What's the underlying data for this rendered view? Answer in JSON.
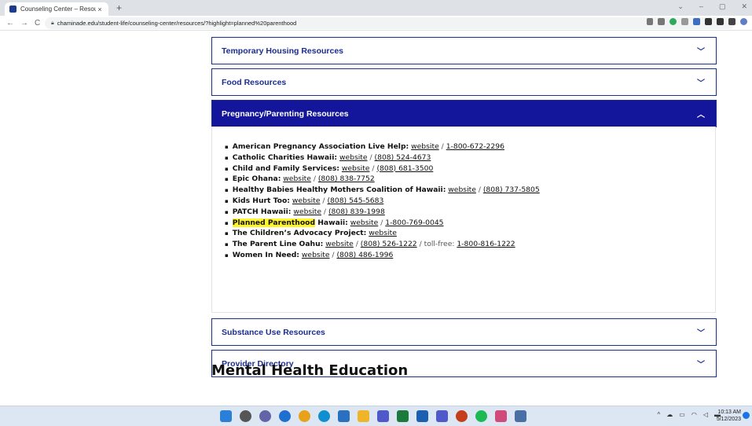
{
  "browser": {
    "tab_title": "Counseling Center – Resources –",
    "tab_close": "×",
    "new_tab": "+",
    "address": "chaminade.edu/student-life/counseling-center/resources/?highlight=planned%20parenthood"
  },
  "accordion": {
    "temporary_housing": "Temporary Housing Resources",
    "food": "Food Resources",
    "pregnancy": "Pregnancy/Parenting Resources",
    "substance": "Substance Use Resources",
    "provider": "Provider Directory"
  },
  "resources": [
    {
      "name": "American Pregnancy Association Live Help:",
      "link": "website",
      "phone": "1-800-672-2296"
    },
    {
      "name": "Catholic Charities Hawaii:",
      "link": "website",
      "phone": "(808) 524-4673"
    },
    {
      "name": "Child and Family Services:",
      "link": "website",
      "phone": "(808) 681-3500"
    },
    {
      "name": "Epic Ohana:",
      "link": "website",
      "phone": "(808) 838-7752"
    },
    {
      "name": "Healthy Babies Healthy Mothers Coalition of Hawaii:",
      "link": "website",
      "phone": "(808) 737-5805"
    },
    {
      "name": "Kids Hurt Too:",
      "link": "website",
      "phone": "(808) 545-5683"
    },
    {
      "name": "PATCH Hawaii:",
      "link": "website",
      "phone": "(808) 839-1998"
    },
    {
      "name_highlight": "Planned Parenthood",
      "name_rest": " Hawaii:",
      "link": "website",
      "phone": "1-800-769-0045"
    },
    {
      "name": "The Children’s Advocacy Project:",
      "link": "website"
    },
    {
      "name": "The Parent Line Oahu:",
      "link": "website",
      "phone": "(808) 526-1222",
      "extra_label": "toll-free:",
      "extra_phone": "1-800-816-1222"
    },
    {
      "name": "Women In Need:",
      "link": "website",
      "phone": "(808) 486-1996"
    }
  ],
  "separator": "/",
  "section_heading": "Mental Health Education",
  "clock": {
    "time": "10:13 AM",
    "date": "5/12/2023"
  }
}
